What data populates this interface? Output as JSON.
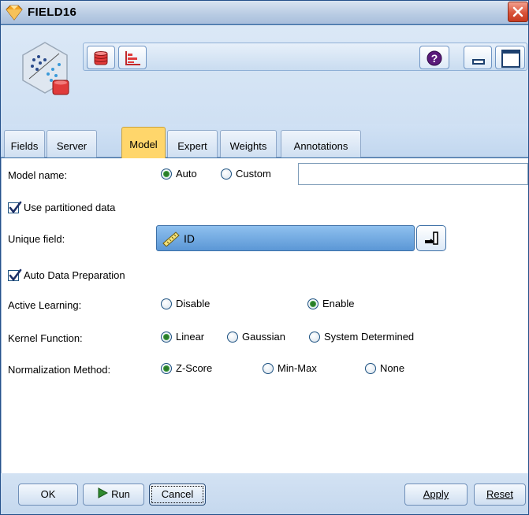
{
  "window": {
    "title": "FIELD16"
  },
  "toolbar": {
    "buttons": [
      {
        "icon": "database-icon"
      },
      {
        "icon": "chart-icon"
      }
    ],
    "right_buttons": [
      {
        "icon": "help-icon"
      },
      {
        "icon": "minimize-icon"
      },
      {
        "icon": "maximize-icon"
      }
    ]
  },
  "tabs": [
    {
      "label": "Fields"
    },
    {
      "label": "Server"
    },
    {
      "label": "Model",
      "active": true
    },
    {
      "label": "Expert"
    },
    {
      "label": "Weights"
    },
    {
      "label": "Annotations"
    }
  ],
  "model": {
    "model_name_label": "Model name:",
    "auto_label": "Auto",
    "custom_label": "Custom",
    "model_name_value": "",
    "name_mode": "Auto",
    "use_partitioned_label": "Use partitioned data",
    "use_partitioned_checked": true,
    "unique_field_label": "Unique field:",
    "unique_field_value": "ID",
    "auto_prep_label": "Auto Data Preparation",
    "auto_prep_checked": true,
    "active_learning_label": "Active Learning:",
    "active_learning_options": [
      "Disable",
      "Enable"
    ],
    "active_learning_selected": "Enable",
    "kernel_label": "Kernel Function:",
    "kernel_options": [
      "Linear",
      "Gaussian",
      "System Determined"
    ],
    "kernel_selected": "Linear",
    "normalization_label": "Normalization Method:",
    "normalization_options": [
      "Z-Score",
      "Min-Max",
      "None"
    ],
    "normalization_selected": "Z-Score"
  },
  "footer": {
    "ok_label": "OK",
    "run_label": "Run",
    "cancel_label": "Cancel",
    "apply_label": "Apply",
    "reset_label": "Reset"
  },
  "colors": {
    "accent_tab": "#ffd66b",
    "field_select": "#6fa7e0",
    "title_bar": "#c4d5ea",
    "close_button": "#d9533a"
  }
}
